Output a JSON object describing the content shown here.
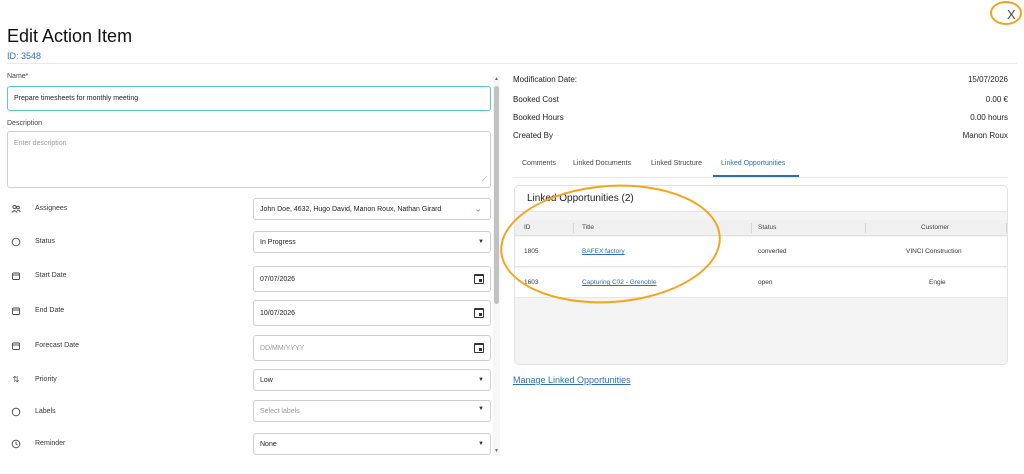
{
  "header": {
    "title": "Edit Action Item",
    "id_text": "ID: 3548",
    "close_label": "X"
  },
  "form": {
    "name_label": "Name*",
    "name_value": "Prepare timesheets for monthly meeting",
    "description_label": "Description",
    "description_placeholder": "Enter description",
    "rows": [
      {
        "icon": "users-icon",
        "label": "Assignees",
        "value": "John Doe, 4632, Hugo David, Manon Roux, Nathan Girard"
      },
      {
        "icon": "circle-icon",
        "label": "Status",
        "value": "In Progress"
      },
      {
        "icon": "calendar-icon",
        "label": "Start Date",
        "value": "07/07/2026"
      },
      {
        "icon": "calendar-icon",
        "label": "End Date",
        "value": "10/07/2026"
      },
      {
        "icon": "calendar-icon",
        "label": "Forecast Date",
        "placeholder": "DD/MM/YYYY"
      },
      {
        "icon": "sort-icon",
        "label": "Priority",
        "value": "Low"
      },
      {
        "icon": "circle-icon",
        "label": "Labels",
        "placeholder": "Select labels"
      },
      {
        "icon": "clock-icon",
        "label": "Reminder",
        "value": "None"
      }
    ]
  },
  "details": {
    "modification_date_label": "Modification Date:",
    "modification_date_value": "15/07/2026",
    "booked_cost_label": "Booked Cost",
    "booked_cost_value": "0.00 €",
    "booked_hours_label": "Booked Hours",
    "booked_hours_value": "0.00 hours",
    "created_by_label": "Created By",
    "created_by_value": "Manon Roux"
  },
  "tabs": [
    "Comments",
    "Linked Documents",
    "Linked Structure",
    "Linked Opportunities"
  ],
  "active_tab": "Linked Opportunities",
  "linked_opportunities": {
    "title": "Linked Opportunities (2)",
    "columns": [
      "ID",
      "Title",
      "Status",
      "Customer"
    ],
    "rows": [
      {
        "id": "1805",
        "title": "BAFEX factory",
        "status": "converted",
        "customer": "VINCI Construction"
      },
      {
        "id": "1603",
        "title": "Capturing C02 - Grenoble",
        "status": "open",
        "customer": "Engie"
      }
    ],
    "manage_label": "Manage Linked Opportunities"
  },
  "colors": {
    "accent": "#2f6fb3",
    "focus_border": "#5ec4d6",
    "annotation": "#f2a51c"
  }
}
